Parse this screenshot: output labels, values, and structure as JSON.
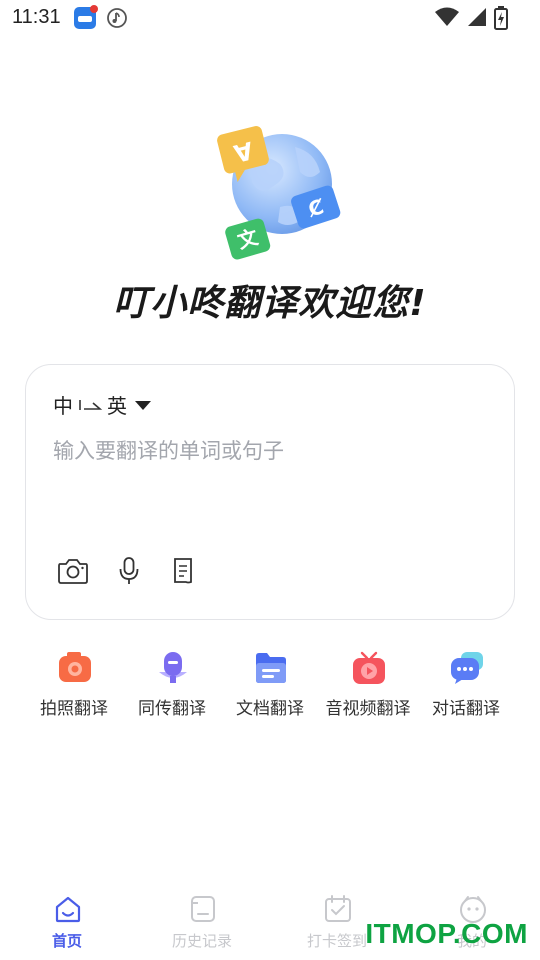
{
  "status_bar": {
    "time": "11:31"
  },
  "app": {
    "welcome_title": "叮小咚翻译欢迎您!"
  },
  "translate_card": {
    "source_lang": "中",
    "target_lang": "英",
    "input_placeholder": "输入要翻译的单词或句子",
    "input_value": ""
  },
  "features": [
    {
      "label": "拍照翻译",
      "icon": "camera-translate-icon",
      "color": "#f76b45"
    },
    {
      "label": "同传翻译",
      "icon": "microphone-translate-icon",
      "color": "#7b6cf0"
    },
    {
      "label": "文档翻译",
      "icon": "document-translate-icon",
      "color": "#4a6cf0"
    },
    {
      "label": "音视频翻译",
      "icon": "video-translate-icon",
      "color": "#f5545d"
    },
    {
      "label": "对话翻译",
      "icon": "dialogue-translate-icon",
      "color": "#5a7cf5"
    }
  ],
  "bottom_nav": {
    "items": [
      {
        "label": "首页",
        "icon": "home-icon",
        "active": true
      },
      {
        "label": "历史记录",
        "icon": "history-icon",
        "active": false
      },
      {
        "label": "打卡签到",
        "icon": "checkin-calendar-icon",
        "active": false
      },
      {
        "label": "我的",
        "icon": "profile-face-icon",
        "active": false
      }
    ]
  },
  "watermark": "ITMOP.COM",
  "colors": {
    "accent": "#4a5de8",
    "inactive": "#c7c8cc",
    "watermark": "#0ea342"
  }
}
